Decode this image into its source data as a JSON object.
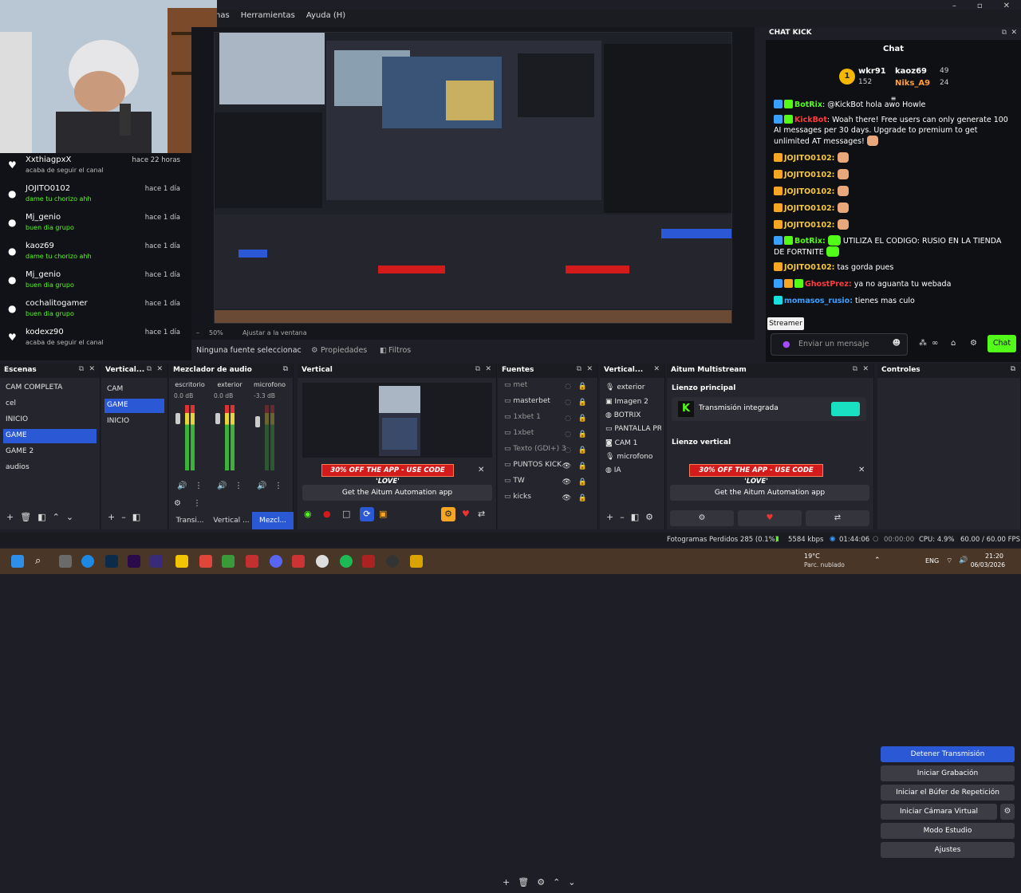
{
  "menu": {
    "items": [
      "nas",
      "Herramientas",
      "Ayuda (H)"
    ]
  },
  "window_controls": [
    "–",
    "▫",
    "✕"
  ],
  "activity": {
    "items": [
      {
        "user": "XxthiagpxX",
        "action": "acaba de seguir el canal",
        "time": "hace 22 horas",
        "icon": "heart-icon",
        "highlight": false
      },
      {
        "user": "JOJITO0102",
        "action": "dame tu chorizo ahh",
        "time": "hace 1 día",
        "icon": "kick-icon",
        "highlight": true
      },
      {
        "user": "Mj_genio",
        "action": "buen dia grupo",
        "time": "hace 1 día",
        "icon": "kick-icon",
        "highlight": true
      },
      {
        "user": "kaoz69",
        "action": "dame tu chorizo ahh",
        "time": "hace 1 día",
        "icon": "kick-icon",
        "highlight": true
      },
      {
        "user": "Mj_genio",
        "action": "buen dia grupo",
        "time": "hace 1 día",
        "icon": "kick-icon",
        "highlight": true
      },
      {
        "user": "cochalitogamer",
        "action": "buen dia grupo",
        "time": "hace 1 día",
        "icon": "kick-icon",
        "highlight": true
      },
      {
        "user": "kodexz90",
        "action": "acaba de seguir el canal",
        "time": "hace 1 día",
        "icon": "heart-icon",
        "highlight": false
      }
    ]
  },
  "preview": {
    "zoom": "50%",
    "zoom_mode": "Ajustar a la ventana"
  },
  "source_bar": {
    "none_selected": "Ninguna fuente seleccionac",
    "properties": "Propiedades",
    "filters": "Filtros"
  },
  "chat": {
    "dock_title": "CHAT KICK",
    "title": "Chat",
    "top": [
      {
        "rank": "1",
        "name": "wkr91",
        "score": "152"
      },
      {
        "name": "kaoz69",
        "score": "49"
      },
      {
        "name": "Niks_A9",
        "score": "24"
      }
    ],
    "messages": [
      {
        "user": "BotRix",
        "user_color": "#53fc18",
        "text": ": @KickBot hola awo Howle"
      },
      {
        "user": "KickBot",
        "user_color": "#ff3b3b",
        "text": ": Woah there! Free users can only generate 100 AI messages per 30 days. Upgrade to premium to get unlimited AT messages!"
      },
      {
        "user": "JOJITO0102:",
        "user_color": "#f5c842",
        "text": ""
      },
      {
        "user": "JOJITO0102:",
        "user_color": "#f5c842",
        "text": ""
      },
      {
        "user": "JOJITO0102:",
        "user_color": "#f5c842",
        "text": ""
      },
      {
        "user": "JOJITO0102:",
        "user_color": "#f5c842",
        "text": ""
      },
      {
        "user": "JOJITO0102:",
        "user_color": "#f5c842",
        "text": ""
      },
      {
        "user": "BotRix:",
        "user_color": "#53fc18",
        "text": " UTILIZA EL CODIGO: RUSIO EN LA TIENDA DE FORTNITE"
      },
      {
        "user": "JOJITO0102:",
        "user_color": "#f5c842",
        "text": " tas gorda pues"
      },
      {
        "user": "GhostPrez:",
        "user_color": "#ff3b3b",
        "text": " ya no aguanta tu webada"
      },
      {
        "user": "momasos_rusio:",
        "user_color": "#3aa0ff",
        "text": " tienes mas culo"
      }
    ],
    "streamer_tooltip": "Streamer",
    "input_placeholder": "Enviar un mensaje",
    "send_label": "Chat"
  },
  "docks": {
    "scenes": {
      "title": "Escenas",
      "items": [
        "CAM COMPLETA",
        "cel",
        "INICIO",
        "GAME",
        "GAME 2",
        "audios"
      ],
      "selected": "GAME"
    },
    "vertical_scenes": {
      "title": "Vertical...",
      "items": [
        "CAM",
        "GAME",
        "INICIO"
      ],
      "selected": "GAME"
    },
    "mixer": {
      "title": "Mezclador de audio",
      "channels": [
        {
          "name": "escritorio",
          "db": "0.0 dB"
        },
        {
          "name": "exterior",
          "db": "0.0 dB"
        },
        {
          "name": "microfono",
          "db": "-3.3 dB"
        }
      ],
      "scale": [
        "0",
        "-5",
        "-10",
        "-15",
        "-20",
        "-25",
        "-30",
        "-35",
        "-40",
        "-45",
        "-50",
        "-55",
        "-60"
      ],
      "tabs": [
        "Transi...",
        "Vertical ...",
        "Mezcl..."
      ]
    },
    "vertical": {
      "title": "Vertical",
      "promo": "30% OFF THE APP - USE CODE 'LOVE'",
      "cta": "Get the Aitum Automation app"
    },
    "sources": {
      "title": "Fuentes",
      "items": [
        "met",
        "masterbet",
        "1xbet 1",
        "1xbet",
        "Texto (GDI+) 3",
        "PUNTOS KICK",
        "TW",
        "kicks"
      ]
    },
    "vertical_sources": {
      "title": "Vertical...",
      "items": [
        "exterior",
        "Imagen 2",
        "BOTRIX",
        "PANTALLA PRI",
        "CAM 1",
        "microfono",
        "IA"
      ]
    },
    "multistream": {
      "title": "Aitum Multistream",
      "main_label": "Lienzo principal",
      "main_stream": "Transmisión integrada",
      "vertical_label": "Lienzo vertical",
      "promo": "30% OFF THE APP - USE CODE 'LOVE'",
      "cta": "Get the Aitum Automation app"
    },
    "controls": {
      "title": "Controles",
      "buttons": [
        "Detener Transmisión",
        "Iniciar Grabación",
        "Iniciar el Búfer de Repetición",
        "Iniciar Cámara Virtual",
        "Modo Estudio",
        "Ajustes"
      ]
    }
  },
  "status": {
    "dropped": "Fotogramas Perdidos 285 (0.1%)",
    "bitrate": "5584 kbps",
    "live_time": "01:44:06",
    "rec_time": "00:00:00",
    "cpu": "CPU: 4.9%",
    "fps": "60.00 / 60.00 FPS"
  },
  "taskbar": {
    "weather_temp": "19°C",
    "weather_desc": "Parc. nublado",
    "lang": "ENG",
    "time": "21:20",
    "date": "06/03/2026"
  },
  "colors": {
    "accent": "#2b59d6",
    "kick_green": "#53fc18",
    "promo_red": "#d41b1b"
  }
}
